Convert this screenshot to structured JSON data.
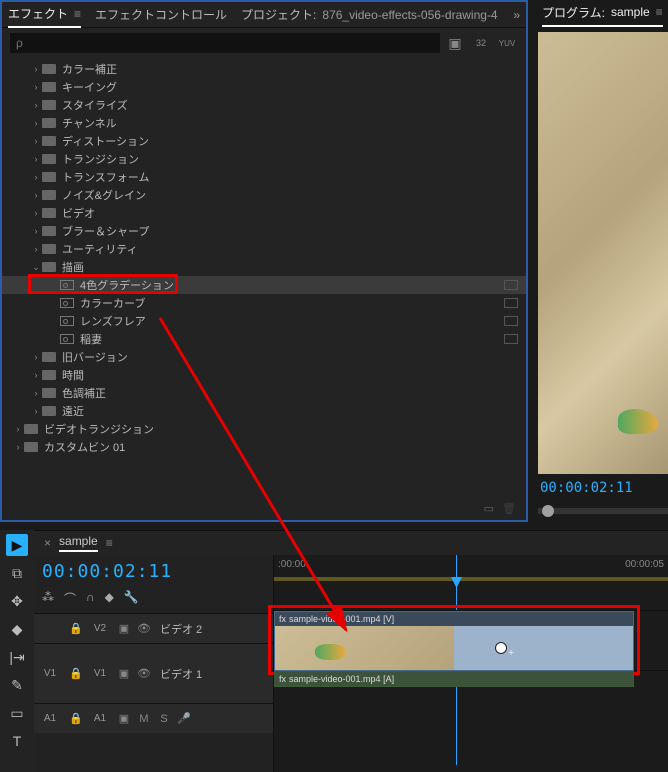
{
  "tabs": {
    "effects": "エフェクト",
    "effect_controls": "エフェクトコントロール",
    "project": "プロジェクト:",
    "project_name": "876_video-effects-056-drawing-4"
  },
  "program_tab_prefix": "プログラム:",
  "program_name": "sample",
  "search_placeholder": "ρ",
  "tree": [
    {
      "indent": 1,
      "type": "folder",
      "label": "カラー補正",
      "chev": "›"
    },
    {
      "indent": 1,
      "type": "folder",
      "label": "キーイング",
      "chev": "›"
    },
    {
      "indent": 1,
      "type": "folder",
      "label": "スタイライズ",
      "chev": "›"
    },
    {
      "indent": 1,
      "type": "folder",
      "label": "チャンネル",
      "chev": "›"
    },
    {
      "indent": 1,
      "type": "folder",
      "label": "ディストーション",
      "chev": "›"
    },
    {
      "indent": 1,
      "type": "folder",
      "label": "トランジション",
      "chev": "›"
    },
    {
      "indent": 1,
      "type": "folder",
      "label": "トランスフォーム",
      "chev": "›"
    },
    {
      "indent": 1,
      "type": "folder",
      "label": "ノイズ&グレイン",
      "chev": "›"
    },
    {
      "indent": 1,
      "type": "folder",
      "label": "ビデオ",
      "chev": "›"
    },
    {
      "indent": 1,
      "type": "folder",
      "label": "ブラー＆シャープ",
      "chev": "›"
    },
    {
      "indent": 1,
      "type": "folder",
      "label": "ユーティリティ",
      "chev": "›"
    },
    {
      "indent": 1,
      "type": "folder",
      "label": "描画",
      "chev": "⌄",
      "open": true
    },
    {
      "indent": 2,
      "type": "fx",
      "label": "4色グラデーション",
      "selected": true,
      "boxed": true
    },
    {
      "indent": 2,
      "type": "fx",
      "label": "カラーカーブ"
    },
    {
      "indent": 2,
      "type": "fx",
      "label": "レンズフレア"
    },
    {
      "indent": 2,
      "type": "fx",
      "label": "稲妻"
    },
    {
      "indent": 1,
      "type": "folder",
      "label": "旧バージョン",
      "chev": "›"
    },
    {
      "indent": 1,
      "type": "folder",
      "label": "時間",
      "chev": "›"
    },
    {
      "indent": 1,
      "type": "folder",
      "label": "色調補正",
      "chev": "›"
    },
    {
      "indent": 1,
      "type": "folder",
      "label": "遠近",
      "chev": "›"
    },
    {
      "indent": 0,
      "type": "folder",
      "label": "ビデオトランジション",
      "chev": "›"
    },
    {
      "indent": 0,
      "type": "folder",
      "label": "カスタムビン 01",
      "chev": "›"
    }
  ],
  "timecode_preview": "00:00:02:11",
  "timeline": {
    "sequence_name": "sample",
    "timecode": "00:00:02:11",
    "ruler_start": ":00:00",
    "ruler_end": "00:00:05",
    "tracks": {
      "v2": "V2",
      "v2_label": "ビデオ 2",
      "v1": "V1",
      "v1_label": "ビデオ 1",
      "a1": "A1",
      "m": "M",
      "s": "S"
    },
    "clip_v": "sample-video-001.mp4 [V]",
    "clip_a": "sample-video-001.mp4 [A]"
  },
  "tools": [
    "▶",
    "⧉",
    "✥",
    "◆",
    "|⇥",
    "✎",
    "▭",
    "T"
  ]
}
